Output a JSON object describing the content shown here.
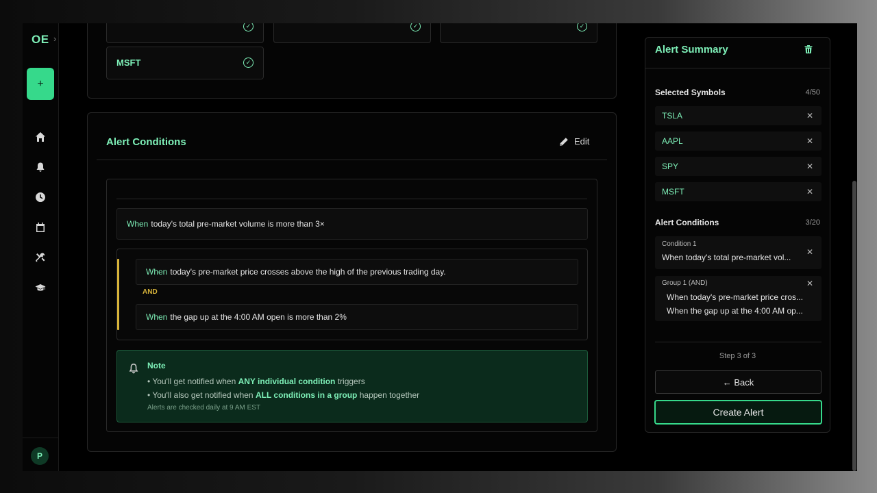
{
  "sidebar": {
    "logo": "OE",
    "logo_arrow": "›",
    "new_button": "+",
    "avatar": "P"
  },
  "symbols_tiles": [
    {
      "label": ""
    },
    {
      "label": ""
    },
    {
      "label": ""
    },
    {
      "label": "MSFT"
    }
  ],
  "conditions": {
    "title": "Alert Conditions",
    "edit_label": "Edit",
    "when": "When",
    "condition_1": "today's total pre-market volume is more than 3×",
    "group": {
      "item_1": "today's pre-market price crosses above the high of the previous trading day.",
      "and_label": "AND",
      "item_2": "the gap up at the 4:00 AM open is more than 2%"
    }
  },
  "note": {
    "title": "Note",
    "line1_pre": "• You'll get notified when ",
    "line1_bold": "ANY individual condition",
    "line1_post": " triggers",
    "line2_pre": "• You'll also get notified when ",
    "line2_bold": "ALL conditions in a group",
    "line2_post": " happen together",
    "small": "Alerts are checked daily at 9 AM EST"
  },
  "summary": {
    "title": "Alert Summary",
    "selected_label": "Selected Symbols",
    "selected_count": "4/50",
    "symbols": [
      "TSLA",
      "AAPL",
      "SPY",
      "MSFT"
    ],
    "conditions_label": "Alert Conditions",
    "conditions_count": "3/20",
    "condition_1_label": "Condition 1",
    "condition_1_text": "When today's total pre-market vol...",
    "group_label": "Group 1 (AND)",
    "group_text_1": "When today's pre-market price cros...",
    "group_text_2": "When the gap up at the 4:00 AM op...",
    "step": "Step 3 of 3",
    "back": "← Back",
    "create": "Create Alert"
  },
  "colors": {
    "accent": "#36d98b",
    "accent_text": "#7ef0b8",
    "and_color": "#d8b43a"
  }
}
